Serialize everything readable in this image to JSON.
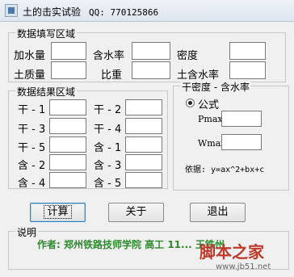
{
  "window": {
    "title": "土的击实试验",
    "qq": "QQ: 770125866"
  },
  "input_group": {
    "title": "数据填写区域",
    "labels": {
      "water_added": "加水量",
      "water_content": "含水率",
      "density": "密度",
      "soil_mass": "土质量",
      "specific_gravity": "比重",
      "soil_water_content": "土含水率"
    },
    "values": {
      "water_added": "",
      "water_content": "",
      "density": "",
      "soil_mass": "",
      "specific_gravity": "",
      "soil_water_content": ""
    }
  },
  "result_group": {
    "title": "数据结果区域",
    "rows": [
      {
        "left": "干 - 1",
        "right": "干 - 2"
      },
      {
        "left": "干 - 3",
        "right": "干 - 4"
      },
      {
        "left": "干 - 5",
        "right": "含 - 1"
      },
      {
        "left": "含 - 2",
        "right": "含 - 3"
      },
      {
        "left": "含 - 4",
        "right": "含 - 5"
      }
    ]
  },
  "formula_group": {
    "title": "干密度 - 含水率",
    "radio_label": "公式",
    "pmax_label": "Pmax",
    "wmax_label": "Wmax",
    "basis": "依据: y=ax^2+bx+c"
  },
  "buttons": {
    "calculate": "计算",
    "about": "关于",
    "exit": "退出"
  },
  "note_group": {
    "title": "说明",
    "author": "作者: 郑州铁路技师学院 高工 11... 王铁州"
  },
  "watermark": {
    "main": "脚本之家",
    "url": "www.jb51.net"
  }
}
